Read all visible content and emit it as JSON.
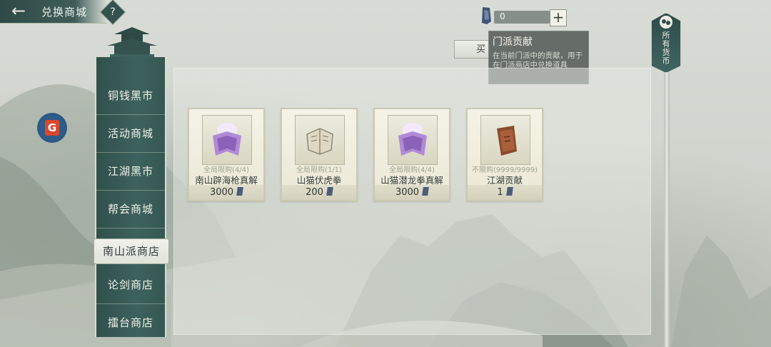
{
  "header": {
    "title": "兑换商城",
    "back_icon": "back-arrow-icon",
    "help_label": "?"
  },
  "currency": {
    "value": "0",
    "add_label": "+",
    "icon": "token-icon"
  },
  "buy_tab": {
    "label": "买"
  },
  "tooltip": {
    "title": "门派贡献",
    "description": "在当前门派中的贡献，用于在门派商店中兑换道具"
  },
  "currency_tag": {
    "label_lines": [
      "所",
      "有",
      "货",
      "币"
    ]
  },
  "badge": {
    "label": "G"
  },
  "menu": {
    "items": [
      {
        "label": "铜钱黑市"
      },
      {
        "label": "活动商城"
      },
      {
        "label": "江湖黑市"
      },
      {
        "label": "帮会商城"
      },
      {
        "label": "南山派商店",
        "active": true
      },
      {
        "label": "论剑商店"
      },
      {
        "label": "擂台商店"
      }
    ]
  },
  "items": [
    {
      "limit": "全局限购(4/4)",
      "name": "南山辟海枪真解",
      "price": "3000",
      "icon": "purple-scroll-icon"
    },
    {
      "limit": "全局限购(1/1)",
      "name": "山猫伏虎拳",
      "price": "200",
      "icon": "book-icon"
    },
    {
      "limit": "全局限购(4/4)",
      "name": "山猫潜龙拳真解",
      "price": "3000",
      "icon": "purple-scroll-icon"
    },
    {
      "limit": "不限购(9999/9999)",
      "name": "江湖贡献",
      "price": "1",
      "icon": "wooden-token-icon"
    }
  ],
  "colors": {
    "menu_bg": "#3d625d",
    "accent_purple": "#b08ad6",
    "card_bg": "#f5f3e6"
  }
}
